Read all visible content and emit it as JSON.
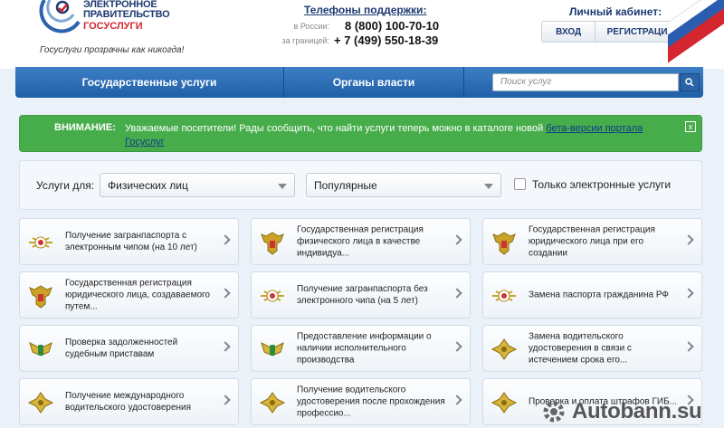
{
  "header": {
    "logo_title_lines": [
      "ЭЛЕКТРОННОЕ",
      "ПРАВИТЕЛЬСТВО"
    ],
    "logo_brand": "ГОСУСЛУГИ",
    "slogan": "Госуслуги прозрачны как никогда!",
    "support_title": "Телефоны поддержки:",
    "phones": [
      {
        "label": "в России:",
        "number": "8 (800) 100-70-10"
      },
      {
        "label": "за границей:",
        "number": "+ 7 (499) 550-18-39"
      }
    ],
    "cabinet_title": "Личный кабинет:",
    "login_label": "ВХОД",
    "register_label": "РЕГИСТРАЦИЯ"
  },
  "nav": {
    "tabs": [
      {
        "label": "Государственные услуги"
      },
      {
        "label": "Органы власти"
      }
    ],
    "search_placeholder": "Поиск услуг"
  },
  "alert": {
    "label": "ВНИМАНИЕ:",
    "text": "Уважаемые посетители! Рады сообщить, что найти услуги теперь можно в каталоге новой ",
    "link_text": "бета-версии портала Госуслуг",
    "close_symbol": "x"
  },
  "filter": {
    "label": "Услуги для:",
    "audience_value": "Физических лиц",
    "sort_value": "Популярные",
    "electronic_only_label": "Только электронные услуги"
  },
  "services": [
    {
      "text": "Получение загранпаспорта с электронным чипом (на 10 лет)",
      "icon": "mvd-icon"
    },
    {
      "text": "Государственная регистрация физического лица в качестве индивидуа...",
      "icon": "eagle-icon"
    },
    {
      "text": "Государственная регистрация юридического лица при его создании",
      "icon": "eagle-icon"
    },
    {
      "text": "Государственная регистрация юридического лица, создаваемого путем...",
      "icon": "eagle-icon"
    },
    {
      "text": "Получение загранпаспорта без электронного чипа (на 5 лет)",
      "icon": "mvd-icon"
    },
    {
      "text": "Замена паспорта гражданина РФ",
      "icon": "mvd-icon"
    },
    {
      "text": "Проверка задолженностей судебным приставам",
      "icon": "fssp-icon"
    },
    {
      "text": "Предоставление информации о наличии исполнительного производства",
      "icon": "fssp-icon"
    },
    {
      "text": "Замена водительского удостоверения в связи с истечением срока его...",
      "icon": "gibdd-icon"
    },
    {
      "text": "Получение международного водительского удостоверения",
      "icon": "gibdd-icon"
    },
    {
      "text": "Получение водительского удостоверения после прохождения профессио...",
      "icon": "gibdd-icon"
    },
    {
      "text": "Проверка и оплата штрафов ГИБ...",
      "icon": "gibdd-icon"
    }
  ],
  "watermark": {
    "text": "Autobann.su"
  },
  "colors": {
    "brand_blue": "#1d3a72",
    "nav_blue": "#2a68b0",
    "alert_green": "#47ad4b",
    "brand_red": "#d3262f"
  }
}
